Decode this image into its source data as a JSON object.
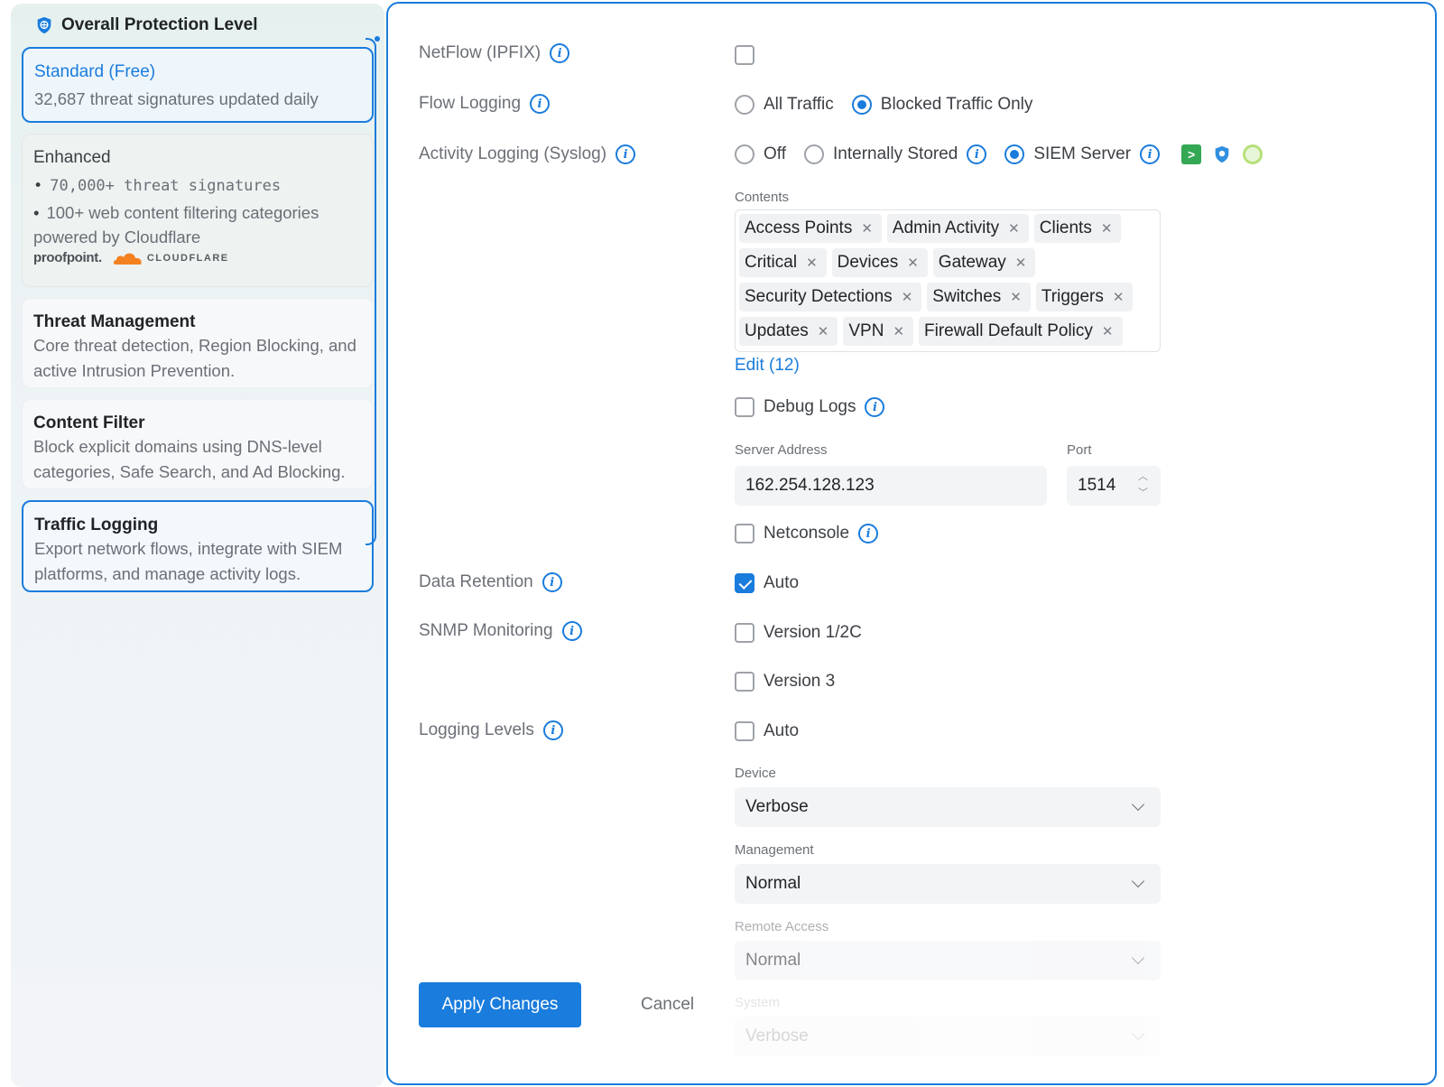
{
  "sidebar": {
    "title": "Overall Protection Level",
    "standard": {
      "title": "Standard (Free)",
      "desc": "32,687 threat signatures updated daily"
    },
    "enhanced": {
      "title": "Enhanced",
      "bullets": [
        "70,000+ threat signatures",
        "100+ web content filtering categories"
      ],
      "powered": "powered by Cloudflare",
      "logo1": "proofpoint.",
      "logo2": "CLOUDFLARE"
    },
    "threat": {
      "title": "Threat Management",
      "desc": "Core threat detection, Region Blocking, and active Intrusion Prevention."
    },
    "content": {
      "title": "Content Filter",
      "desc": "Block explicit domains using DNS-level categories, Safe Search, and Ad Blocking."
    },
    "traffic": {
      "title": "Traffic Logging",
      "desc": "Export network flows, integrate with SIEM platforms, and manage activity logs."
    }
  },
  "form": {
    "netflow": {
      "label": "NetFlow (IPFIX)",
      "checked": false
    },
    "flow_logging": {
      "label": "Flow Logging",
      "options": [
        "All Traffic",
        "Blocked Traffic Only"
      ],
      "selected": "Blocked Traffic Only"
    },
    "activity_logging": {
      "label": "Activity Logging (Syslog)",
      "options": [
        "Off",
        "Internally Stored",
        "SIEM Server"
      ],
      "selected": "SIEM Server"
    },
    "contents_label": "Contents",
    "contents": [
      "Access Points",
      "Admin Activity",
      "Clients",
      "Critical",
      "Devices",
      "Gateway",
      "Security Detections",
      "Switches",
      "Triggers",
      "Updates",
      "VPN",
      "Firewall Default Policy"
    ],
    "edit_link": "Edit (12)",
    "debug_logs": {
      "label": "Debug Logs",
      "checked": false
    },
    "server_address": {
      "label": "Server Address",
      "value": "162.254.128.123"
    },
    "port": {
      "label": "Port",
      "value": "1514"
    },
    "netconsole": {
      "label": "Netconsole",
      "checked": false
    },
    "data_retention": {
      "label": "Data Retention",
      "option": "Auto",
      "checked": true
    },
    "snmp": {
      "label": "SNMP Monitoring",
      "v12c": "Version 1/2C",
      "v3": "Version 3"
    },
    "logging_levels": {
      "label": "Logging Levels",
      "auto": "Auto"
    },
    "device": {
      "label": "Device",
      "value": "Verbose"
    },
    "management": {
      "label": "Management",
      "value": "Normal"
    },
    "remote_access": {
      "label": "Remote Access",
      "value": "Normal"
    },
    "system": {
      "label": "System",
      "value": "Verbose"
    }
  },
  "actions": {
    "apply": "Apply Changes",
    "cancel": "Cancel"
  },
  "colors": {
    "accent": "#1a7cdc"
  },
  "icons": [
    "shield-icon",
    "info-icon",
    "check-icon",
    "chevron-down-icon",
    "close-icon",
    "siem-splunk-icon",
    "siem-shield-icon",
    "siem-q-icon"
  ]
}
